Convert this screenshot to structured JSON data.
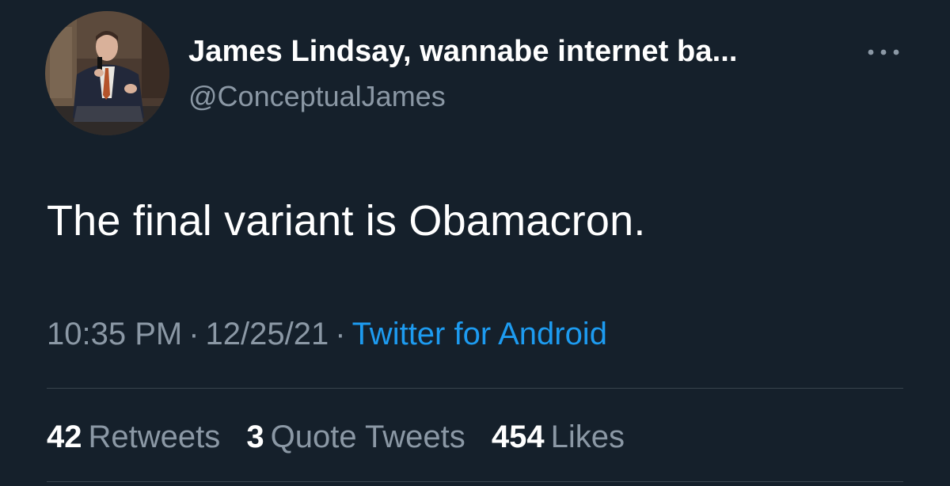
{
  "author": {
    "display_name": "James Lindsay, wannabe internet ba...",
    "handle": "@ConceptualJames",
    "avatar_icon": "profile-photo"
  },
  "more_icon": "more-horizontal-icon",
  "tweet": {
    "text": "The final variant is Obamacron."
  },
  "meta": {
    "time": "10:35 PM",
    "separator": "·",
    "date": "12/25/21",
    "source": "Twitter for Android"
  },
  "stats": {
    "retweets_count": "42",
    "retweets_label": "Retweets",
    "quotes_count": "3",
    "quotes_label": "Quote Tweets",
    "likes_count": "454",
    "likes_label": "Likes"
  },
  "colors": {
    "background": "#15202b",
    "secondary_text": "#8b98a5",
    "link": "#1d9bf0",
    "divider": "#38444d"
  }
}
